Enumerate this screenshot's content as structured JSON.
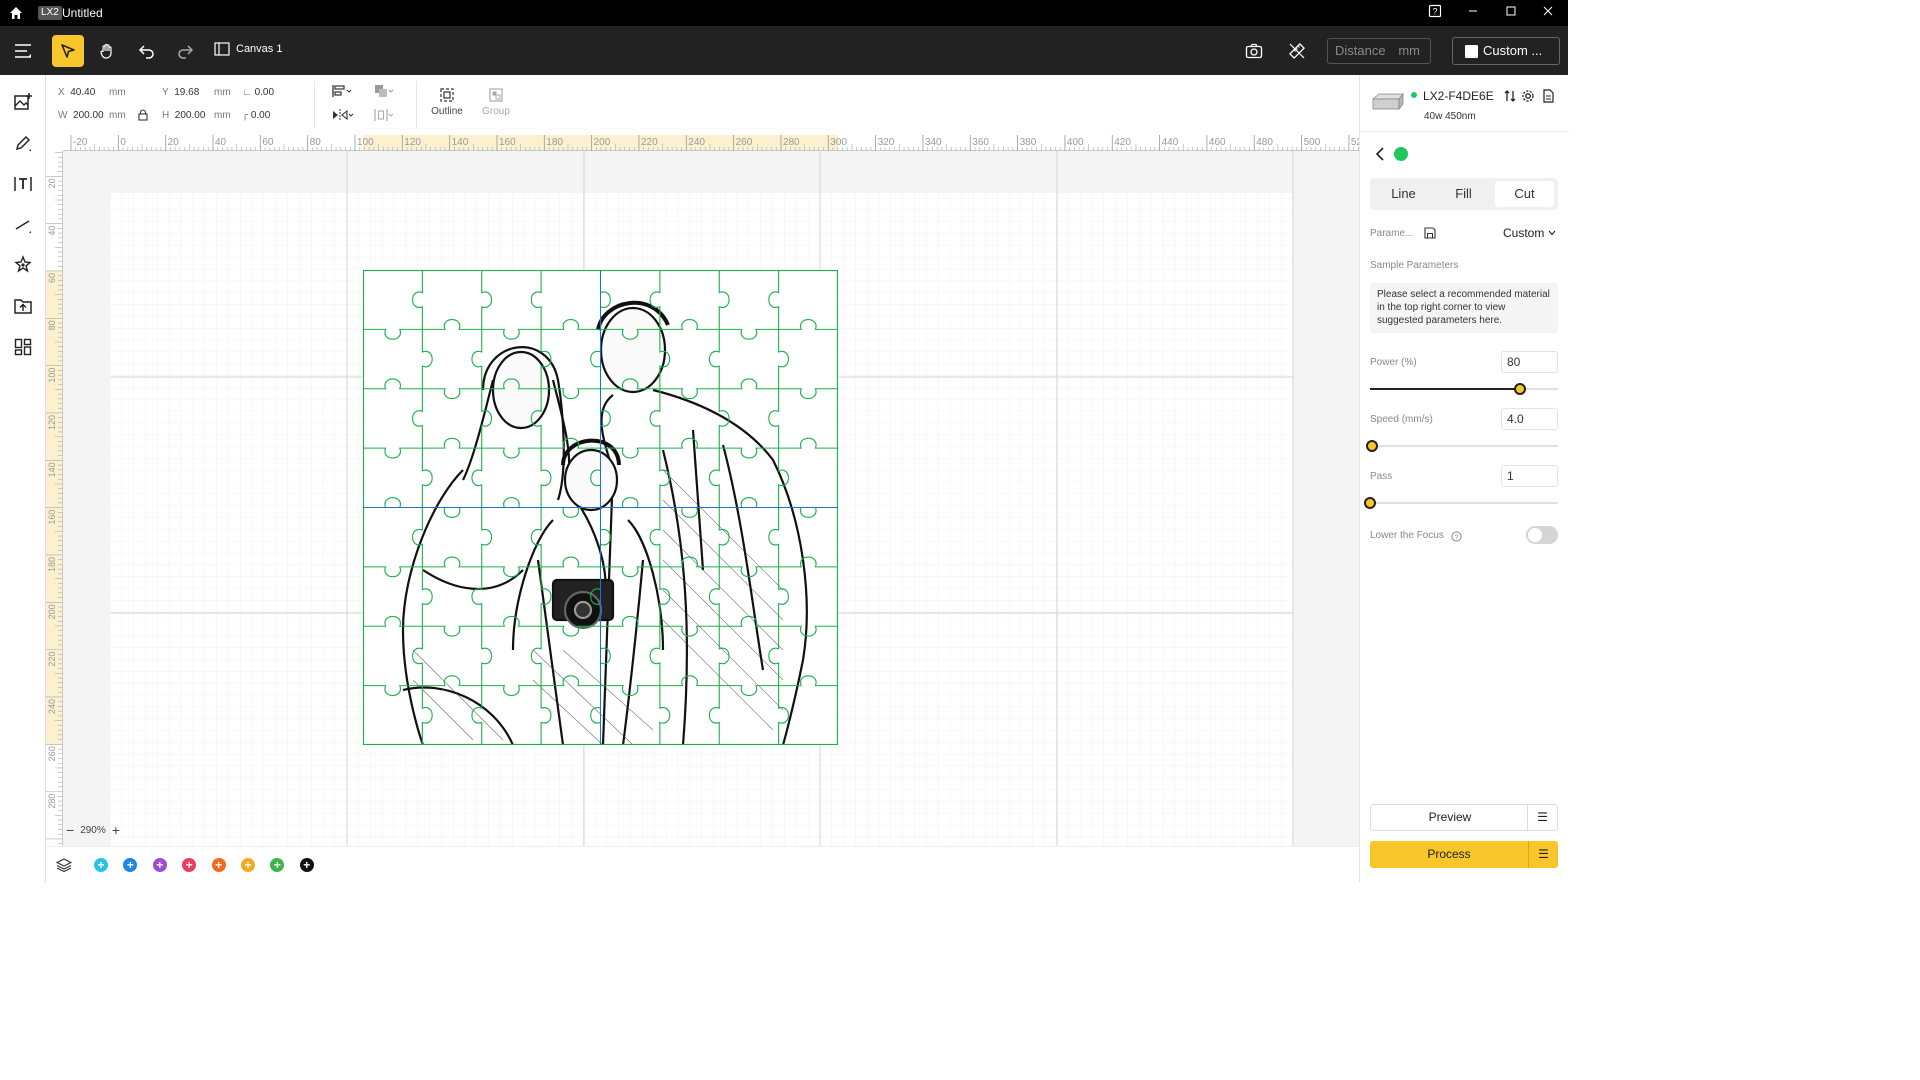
{
  "window": {
    "badge": "LX2",
    "title": "Untitled"
  },
  "toolbar": {
    "canvas_label": "Canvas 1",
    "distance_placeholder": "Distance",
    "distance_unit": "mm",
    "material_label": "Custom ..."
  },
  "properties": {
    "x_label": "X",
    "x_value": "40.40",
    "x_unit": "mm",
    "y_label": "Y",
    "y_value": "19.68",
    "y_unit": "mm",
    "w_label": "W",
    "w_value": "200.00",
    "w_unit": "mm",
    "h_label": "H",
    "h_value": "200.00",
    "h_unit": "mm",
    "rotation_value": "0.00",
    "corner_value": "0.00",
    "outline_label": "Outline",
    "group_label": "Group"
  },
  "ruler": {
    "h_ticks": [
      "-20",
      "0",
      "20",
      "40",
      "60",
      "80",
      "100",
      "120",
      "140",
      "160",
      "180",
      "200",
      "220",
      "240",
      "260",
      "280",
      "300",
      "320",
      "340",
      "360",
      "380",
      "400",
      "420",
      "440",
      "460",
      "480",
      "500",
      "520"
    ],
    "v_ticks": [
      "20",
      "40",
      "60",
      "80",
      "100",
      "120",
      "140",
      "160",
      "180",
      "200",
      "220",
      "240",
      "260",
      "280"
    ]
  },
  "zoom": {
    "value": "290%"
  },
  "layers": {
    "colors": [
      "#29c3e6",
      "#1e88e5",
      "#9c4dd6",
      "#ef3b5c",
      "#f26a1b",
      "#f7a823",
      "#3cb54a",
      "#111111"
    ]
  },
  "device": {
    "name": "LX2-F4DE6E",
    "spec": "40w 450nm",
    "status_color": "#22c55e"
  },
  "panel": {
    "tabs": [
      "Line",
      "Fill",
      "Cut"
    ],
    "selected_tab": "Cut",
    "params_label": "Parame...",
    "params_value": "Custom",
    "sample_title": "Sample Parameters",
    "sample_notice": "Please select a recommended material in the top right corner to view suggested parameters here.",
    "power_label": "Power  (%)",
    "power_value": "80",
    "power_fraction": 0.8,
    "speed_label": "Speed  (mm/s)",
    "speed_value": "4.0",
    "speed_fraction": 0.01,
    "pass_label": "Pass",
    "pass_value": "1",
    "pass_fraction": 0.0,
    "focus_label": "Lower the Focus",
    "focus_on": false,
    "preview_label": "Preview",
    "process_label": "Process"
  },
  "accent": "#f8c52b"
}
